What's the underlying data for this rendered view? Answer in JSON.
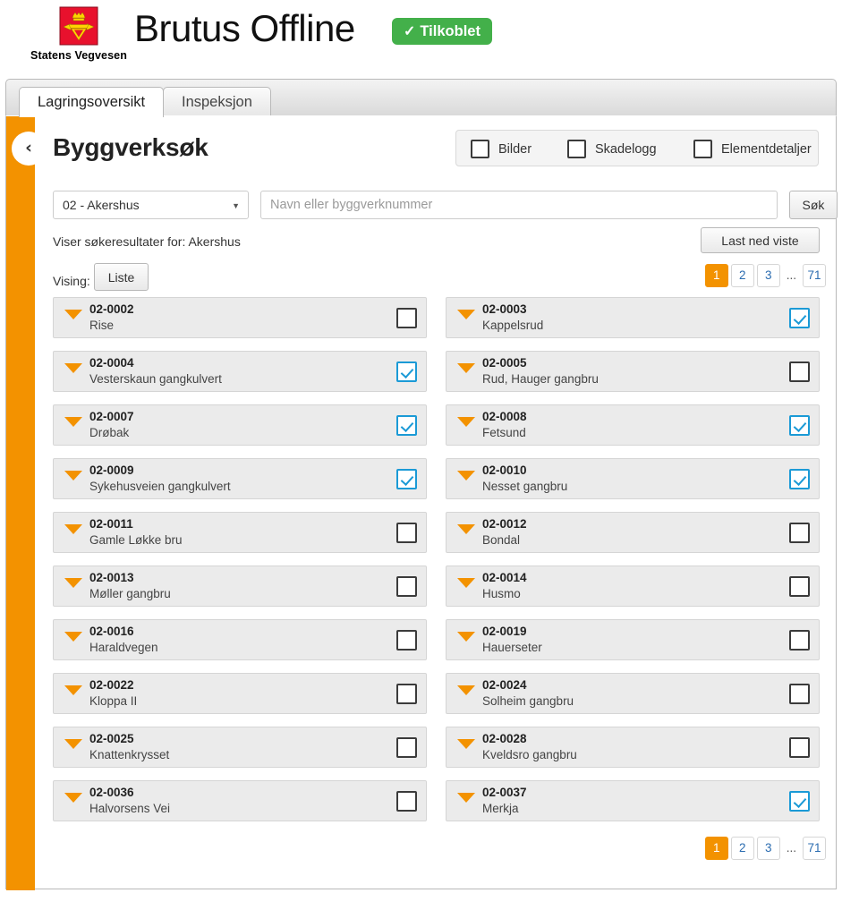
{
  "header": {
    "logo_alt": "Statens Vegvesen",
    "logo_caption": "Statens Vegvesen",
    "app_title": "Brutus Offline",
    "status_badge": {
      "check": "✓",
      "label": "Tilkoblet",
      "color": "#43b04a"
    }
  },
  "tabs": [
    {
      "label": "Lagringsoversikt",
      "active": true
    },
    {
      "label": "Inspeksjon",
      "active": false
    }
  ],
  "sidebar": {
    "accent_color": "#f39200",
    "collapse_icon": "‹"
  },
  "main": {
    "page_title": "Byggverksøk",
    "filters": [
      {
        "label": "Bilder",
        "checked": false
      },
      {
        "label": "Skadelogg",
        "checked": false
      },
      {
        "label": "Elementdetaljer",
        "checked": false
      }
    ],
    "county_select": {
      "value": "02 - Akershus",
      "caret": "▼"
    },
    "search": {
      "value": "",
      "placeholder": "Navn eller byggverknummer"
    },
    "search_button": "Søk",
    "results_text": "Viser søkeresultater for: Akershus",
    "download_button": "Last ned viste",
    "vising_label": "Vising:",
    "vising_button": "Liste",
    "pagination": {
      "pages": [
        "1",
        "2",
        "3",
        "...",
        "71"
      ],
      "current": "1",
      "active_color": "#f39200"
    },
    "results": {
      "left": [
        {
          "number": "02-0002",
          "name": "Rise",
          "checked": false
        },
        {
          "number": "02-0004",
          "name": "Vesterskaun gangkulvert",
          "checked": true
        },
        {
          "number": "02-0007",
          "name": "Drøbak",
          "checked": true
        },
        {
          "number": "02-0009",
          "name": "Sykehusveien gangkulvert",
          "checked": true
        },
        {
          "number": "02-0011",
          "name": "Gamle Løkke bru",
          "checked": false
        },
        {
          "number": "02-0013",
          "name": "Møller gangbru",
          "checked": false
        },
        {
          "number": "02-0016",
          "name": "Haraldvegen",
          "checked": false
        },
        {
          "number": "02-0022",
          "name": "Kloppa II",
          "checked": false
        },
        {
          "number": "02-0025",
          "name": "Knattenkrysset",
          "checked": false
        },
        {
          "number": "02-0036",
          "name": "Halvorsens Vei",
          "checked": false
        }
      ],
      "right": [
        {
          "number": "02-0003",
          "name": "Kappelsrud",
          "checked": true
        },
        {
          "number": "02-0005",
          "name": "Rud, Hauger gangbru",
          "checked": false
        },
        {
          "number": "02-0008",
          "name": "Fetsund",
          "checked": true
        },
        {
          "number": "02-0010",
          "name": "Nesset gangbru",
          "checked": true
        },
        {
          "number": "02-0012",
          "name": "Bondal",
          "checked": false
        },
        {
          "number": "02-0014",
          "name": "Husmo",
          "checked": false
        },
        {
          "number": "02-0019",
          "name": "Hauerseter",
          "checked": false
        },
        {
          "number": "02-0024",
          "name": "Solheim gangbru",
          "checked": false
        },
        {
          "number": "02-0028",
          "name": "Kveldsro gangbru",
          "checked": false
        },
        {
          "number": "02-0037",
          "name": "Merkja",
          "checked": true
        }
      ]
    }
  }
}
